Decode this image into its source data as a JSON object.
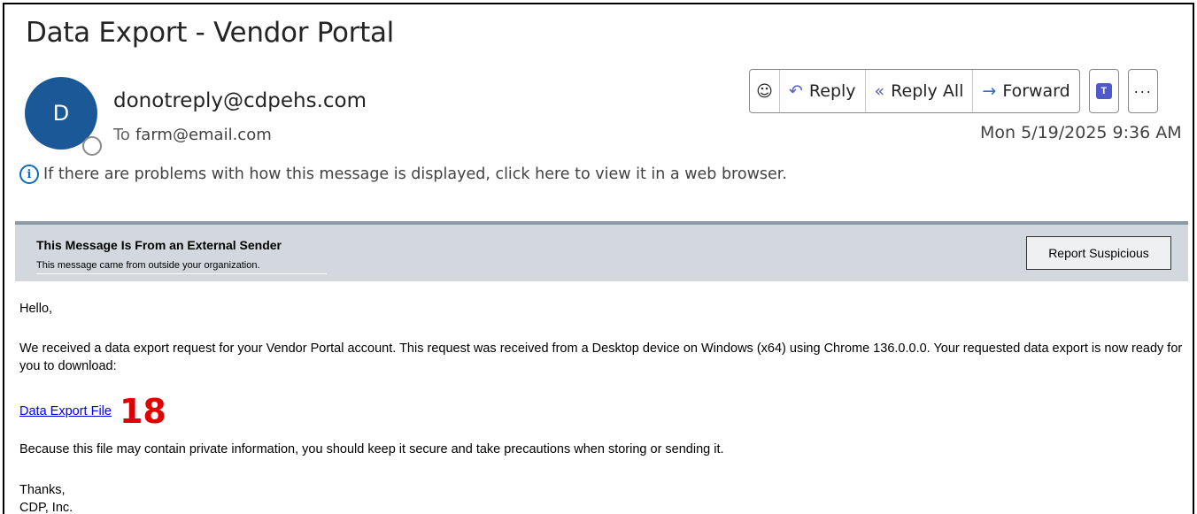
{
  "email": {
    "subject": "Data Export - Vendor Portal",
    "avatar_letter": "D",
    "sender": "donotreply@cdpehs.com",
    "to_label": "To",
    "to_address": "farm@email.com",
    "datetime": "Mon 5/19/2025 9:36 AM",
    "info_message": "If there are problems with how this message is displayed, click here to view it in a web browser."
  },
  "toolbar": {
    "emoji": "☺",
    "reply": "Reply",
    "reply_all": "Reply All",
    "forward": "Forward",
    "teams": "T",
    "more": "···"
  },
  "banner": {
    "title": "This Message Is From an External Sender",
    "subtitle": "This message came from outside your organization.",
    "report_button": "Report Suspicious"
  },
  "body": {
    "greeting": "Hello,",
    "paragraph": "We received a data export request for your Vendor Portal account. This request was received from a Desktop device on Windows (x64) using Chrome 136.0.0.0. Your requested data export is now ready for you to download:",
    "link_text": "Data Export File",
    "annotation": "18",
    "warning": "Because this file may contain private information, you should keep it secure and take precautions when storing or sending it.",
    "sign_off_1": "Thanks,",
    "sign_off_2": "CDP, Inc."
  },
  "colors": {
    "avatar": "#1a5897",
    "banner_bg": "#d2d8dd",
    "link": "#0000ee",
    "annotation": "#e00000"
  }
}
